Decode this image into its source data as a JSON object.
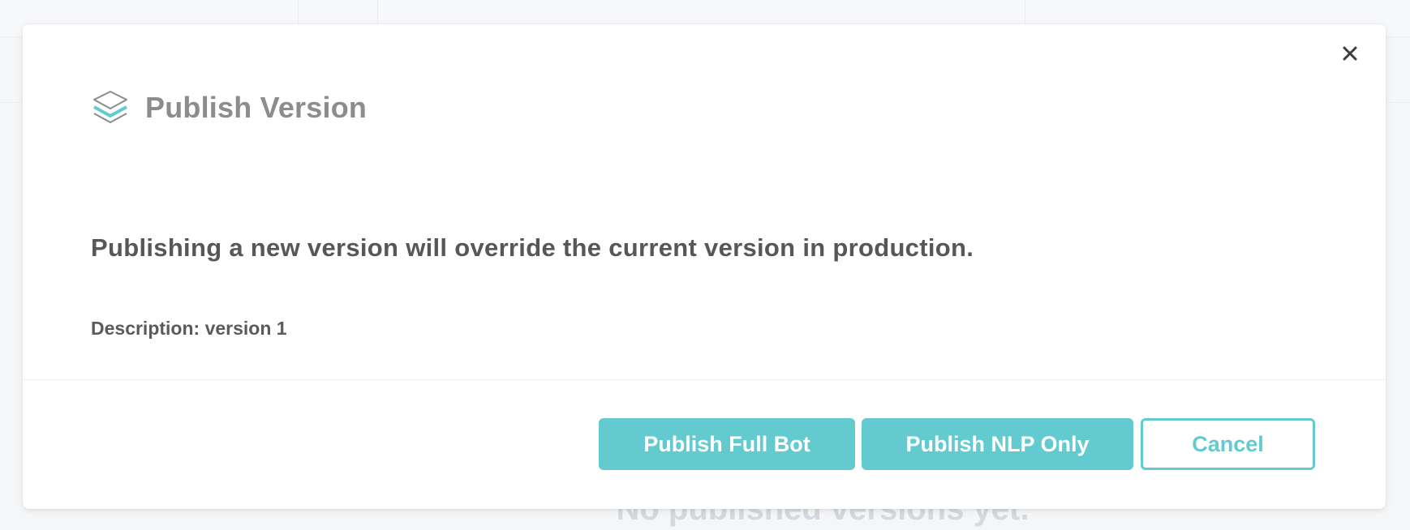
{
  "background": {
    "empty_state_text": "No published versions yet."
  },
  "modal": {
    "title": "Publish Version",
    "title_icon": "layers-icon",
    "close_icon": "close-icon",
    "message": "Publishing a new version will override the current version in production.",
    "description": "Description: version 1",
    "buttons": {
      "publish_full_bot": "Publish Full Bot",
      "publish_nlp_only": "Publish NLP Only",
      "cancel": "Cancel"
    }
  },
  "colors": {
    "accent": "#63cbcf",
    "title_text": "#8a8c8e",
    "body_text": "#555759"
  }
}
